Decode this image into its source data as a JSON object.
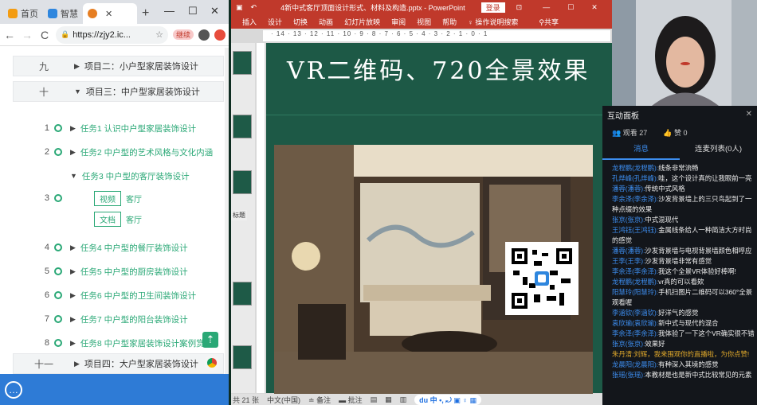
{
  "browser": {
    "tabs": [
      {
        "label": "首页",
        "icon": "app-icon"
      },
      {
        "label": "智慧",
        "icon": "app-icon"
      },
      {
        "label": "",
        "icon": "hand-icon"
      }
    ],
    "new_tab": "+",
    "url": "https://zjy2.ic...",
    "ext_label": "继续"
  },
  "course": {
    "units": [
      {
        "num": "九",
        "title": "项目二：小户型家居装饰设计",
        "expanded": false
      },
      {
        "num": "十",
        "title": "项目三：中户型家居装饰设计",
        "expanded": true
      },
      {
        "num": "十一",
        "title": "项目四：大户型家居装饰设计",
        "expanded": false
      }
    ],
    "tasks": [
      {
        "idx": "1",
        "title": "任务1 认识中户型家居装饰设计"
      },
      {
        "idx": "2",
        "title": "任务2 中户型的艺术风格与文化内涵"
      },
      {
        "idx": "",
        "title": "任务3 中户型的客厅装饰设计"
      },
      {
        "idx": "4",
        "title": "任务4 中户型的餐厅装饰设计"
      },
      {
        "idx": "5",
        "title": "任务5 中户型的厨房装饰设计"
      },
      {
        "idx": "6",
        "title": "任务6 中户型的卫生间装饰设计"
      },
      {
        "idx": "7",
        "title": "任务7 中户型的阳台装饰设计"
      },
      {
        "idx": "8",
        "title": "任务8 中户型家居装饰设计案例赏析"
      }
    ],
    "task3_index": "3",
    "subitems": [
      {
        "chip": "视频",
        "label": "客厅"
      },
      {
        "chip": "文档",
        "label": "客厅"
      }
    ]
  },
  "ppt": {
    "filename": "4新中式客厅顶面设计形式、材料及构造.pptx - PowerPoint",
    "login": "登录",
    "ribbon": [
      "插入",
      "设计",
      "切换",
      "动画",
      "幻灯片放映",
      "审阅",
      "视图",
      "帮助",
      "操作说明搜索",
      "共享"
    ],
    "ruler": "· 14 · 13 · 12 · 11 · 10 · 9 · 8 · 7 · 6 · 5 · 4 · 3 · 2 · 1 · 0 · 1",
    "placeholder": "标题",
    "slide_title": "VR二维码、720全景效果",
    "status": [
      "共 21 张",
      "中文(中国)",
      "备注",
      "批注"
    ]
  },
  "panel": {
    "title": "互动面板",
    "viewers": "观看 27",
    "likes": "赞 0",
    "tab_msg": "消息",
    "tab_queue": "连麦列表(0人)",
    "messages": [
      {
        "user": "龙程鹏(龙程鹏):",
        "text": "线条非常流畅"
      },
      {
        "user": "孔烨峰(孔烨峰):",
        "text": "哇，这个设计真的让我眼前一亮"
      },
      {
        "user": "潘蓉(潘蓉):",
        "text": "传统中式风格"
      },
      {
        "user": "李余泽(李余泽):",
        "text": "沙发背景墙上的三只鸟起到了一种点缀的效果"
      },
      {
        "user": "张京(张京):",
        "text": "中式混现代"
      },
      {
        "user": "王鸿钰(王鸿钰):",
        "text": "金属线条给人一种简洁大方时尚的感觉"
      },
      {
        "user": "潘蓉(潘蓉):",
        "text": "沙发背景墙与电视背景墙颜色相呼应"
      },
      {
        "user": "王李(王李):",
        "text": "沙发背景墙非常有感觉"
      },
      {
        "user": "李余泽(李余泽):",
        "text": "我这个全景VR体验好棒啊!"
      },
      {
        "user": "龙程鹏(龙程鹏):",
        "text": "vr真的可以看欸"
      },
      {
        "user": "阳慧玲(阳慧玲):",
        "text": "手机扫图片二维码可以360°全景观看喔"
      },
      {
        "user": "李涵钦(李涵钦):",
        "text": "好洋气的感觉"
      },
      {
        "user": "袁欣瑜(袁欣瑜):",
        "text": "新中式与现代的混合"
      },
      {
        "user": "李余泽(李余泽):",
        "text": "我体验了一下这个VR确实很不错"
      },
      {
        "user": "张京(张京):",
        "text": "效果好"
      },
      {
        "user": "朱丹清:",
        "text": "刘辉，我来围观你的直播啦，为你点赞!",
        "highlight": true
      },
      {
        "user": "龙晨阳(龙晨阳):",
        "text": "有种深入其境的感觉"
      },
      {
        "user": "张瑶(张瑶):",
        "text": "本教材是也是新中式比较常见的元素"
      }
    ]
  },
  "colors": {
    "accent_green": "#2aa876",
    "ppt_red": "#c0392b",
    "slide_bg": "#1d5946",
    "link_blue": "#3d8ef0"
  }
}
